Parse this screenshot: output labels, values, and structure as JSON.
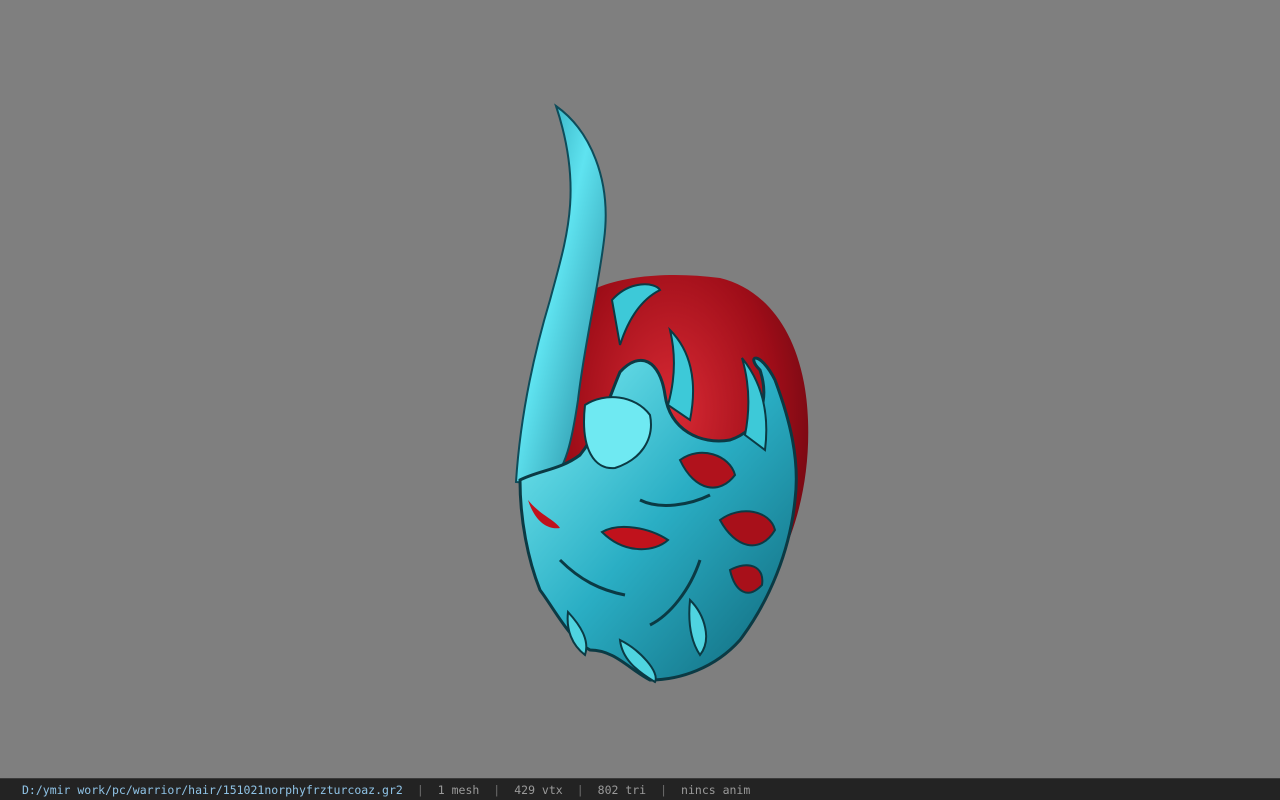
{
  "viewport": {
    "background_color": "#7f7f7f",
    "model": {
      "icon": "helmet-model",
      "primary_color": "#2fb6c8",
      "accent_color": "#b0121c",
      "shadow_color": "#0b3a44"
    }
  },
  "statusbar": {
    "file_path": "D:/ymir work/pc/warrior/hair/151021norphyfrzturcoaz.gr2",
    "separator": "|",
    "mesh": "1 mesh",
    "vertices": "429 vtx",
    "triangles": "802 tri",
    "animation": "nincs anim",
    "path_color": "#8fc3e6",
    "text_color": "#9a9a9a"
  }
}
